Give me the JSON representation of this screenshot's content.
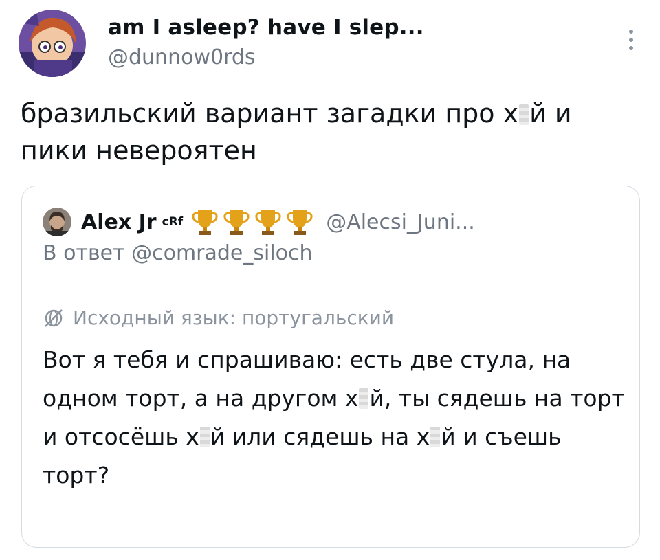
{
  "tweet": {
    "display_name": "am I asleep? have I slep...",
    "handle": "@dunnow0rds",
    "text_parts": [
      "бразильский вариант загадки про х",
      "й и пики невероятен"
    ]
  },
  "quote": {
    "display_name": "Alex Jr",
    "name_sup": "cRf",
    "trophy_icons": [
      "trophy-icon",
      "trophy-icon",
      "trophy-icon",
      "trophy-icon"
    ],
    "handle": "@Alecsi_Juni...",
    "reply_to": "В ответ @comrade_siloch",
    "translation_label": "Исходный язык: португальский",
    "text_parts": [
      "Вот я тебя и спрашиваю: есть две стула, на одном торт, а на другом х",
      "й, ты сядешь на торт и отсосёшь х",
      "й или сядешь на х",
      "й и съешь торт?"
    ]
  },
  "icons": {
    "more": "more-vertical-icon",
    "globe": "globe-translate-icon"
  },
  "colors": {
    "text_primary": "#0f1419",
    "text_secondary": "#6e7781",
    "border": "#d4dbe1",
    "trophy_gold": "#e3a21a"
  }
}
